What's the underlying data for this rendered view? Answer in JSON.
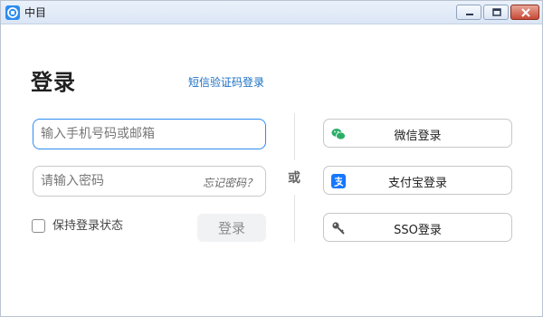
{
  "window": {
    "title": "中目",
    "controls": [
      "minimize",
      "maximize",
      "close"
    ]
  },
  "login": {
    "heading": "登录",
    "sms_link": "短信验证码登录",
    "username_placeholder": "输入手机号码或邮箱",
    "password_placeholder": "请输入密码",
    "forgot_password": "忘记密码？",
    "remember_label": "保持登录状态",
    "remember_checked": false,
    "submit_label": "登录"
  },
  "separator_text": "或",
  "alt_logins": [
    {
      "label": "微信登录",
      "icon": "wechat-icon",
      "color": "#2aae67"
    },
    {
      "label": "支付宝登录",
      "icon": "alipay-icon",
      "color": "#1677ff"
    },
    {
      "label": "SSO登录",
      "icon": "key-icon",
      "color": "#555555"
    }
  ],
  "colors": {
    "accent": "#2d8cf0",
    "link": "#1a6fc4",
    "disabled_button_bg": "#f1f2f4"
  }
}
